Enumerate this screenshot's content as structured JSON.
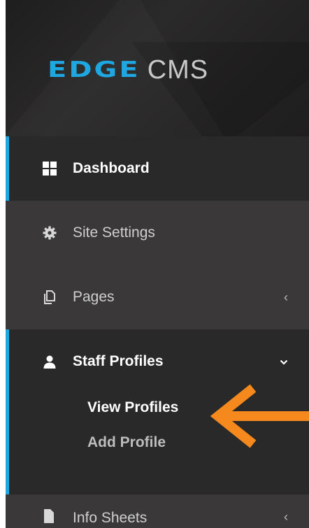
{
  "brand": {
    "logo_main": "EDGE",
    "logo_sub": "CMS",
    "accent": "#1fa7e1"
  },
  "menu": {
    "dashboard": {
      "label": "Dashboard",
      "icon": "grid-icon"
    },
    "site_settings": {
      "label": "Site Settings",
      "icon": "gear-icon"
    },
    "pages": {
      "label": "Pages",
      "icon": "copy-icon",
      "chevron": "‹"
    },
    "staff_profiles": {
      "label": "Staff Profiles",
      "icon": "user-icon",
      "chevron": "⌄",
      "children": [
        {
          "label": "View Profiles"
        },
        {
          "label": "Add Profile"
        }
      ]
    },
    "info_sheets": {
      "label": "Info Sheets",
      "icon": "file-icon",
      "chevron": "‹"
    }
  },
  "annotation": {
    "arrow_color": "#f5891e"
  }
}
